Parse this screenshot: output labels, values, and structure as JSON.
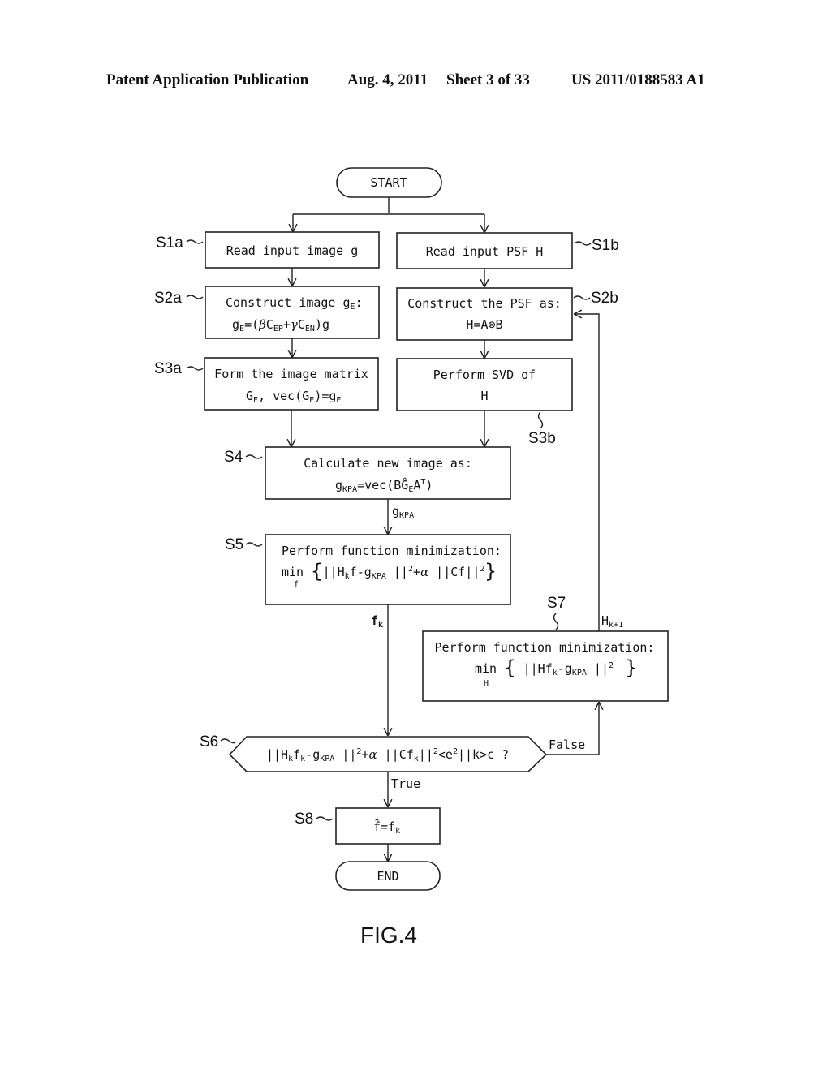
{
  "header": {
    "publication": "Patent Application Publication",
    "date": "Aug. 4, 2011",
    "sheet": "Sheet 3 of 33",
    "number": "US 2011/0188583 A1"
  },
  "figure_label": "FIG.4",
  "terminals": {
    "start": "START",
    "end": "END"
  },
  "steps": {
    "s1a": {
      "id": "S1a",
      "line1": "Read input image g"
    },
    "s1b": {
      "id": "S1b",
      "line1": "Read input PSF H"
    },
    "s2a": {
      "id": "S2a",
      "line1": "Construct image gE:",
      "line2": "gE=(βCEP+γCEN)g"
    },
    "s2b": {
      "id": "S2b",
      "line1": "Construct the PSF as:",
      "line2": "H=A⊗B"
    },
    "s3a": {
      "id": "S3a",
      "line1": "Form the image matrix",
      "line2": "GE, vec(GE)=gE"
    },
    "s3b": {
      "id": "S3b",
      "line1": "Perform SVD of",
      "line2": "H"
    },
    "s4": {
      "id": "S4",
      "line1": "Calculate new image as:",
      "line2": "gKPA=vec(BĜEAᵀ)"
    },
    "s5": {
      "id": "S5",
      "line1": "Perform function minimization:",
      "line2": "min_f {||Hkf-gKPA||²+α||Cf||²}"
    },
    "s6": {
      "id": "S6",
      "condition": "||Hkfk-gKPA||²+α||Cfk||²<e²||k>c ?"
    },
    "s7": {
      "id": "S7",
      "line1": "Perform function minimization:",
      "line2": "min_H {||Hfk-gKPA||²}"
    },
    "s8": {
      "id": "S8",
      "line1": "f̂=fk"
    }
  },
  "edge_labels": {
    "gkpa": "gKPA",
    "fk": "fk",
    "hk1": "Hk+1",
    "true": "True",
    "false": "False"
  }
}
